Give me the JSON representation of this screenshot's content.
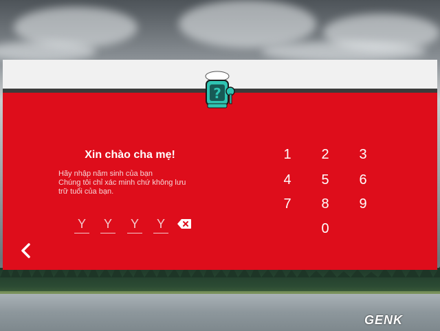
{
  "dialog": {
    "title": "Xin chào cha mẹ!",
    "instructions": [
      "Hãy nhập năm sinh của bạn",
      "Chúng tôi chỉ xác minh chứ không lưu",
      "trữ tuổi của bạn."
    ],
    "year_placeholders": [
      "Y",
      "Y",
      "Y",
      "Y"
    ],
    "keypad": [
      "1",
      "2",
      "3",
      "4",
      "5",
      "6",
      "7",
      "8",
      "9",
      "0"
    ],
    "accent_color": "#de0d1b",
    "header_color": "#f1f1f1"
  },
  "icons": {
    "logo": "youtube-kids-robot-logo-icon",
    "backspace": "backspace-icon",
    "back": "chevron-left-icon"
  },
  "watermark": {
    "text": "GENK"
  }
}
